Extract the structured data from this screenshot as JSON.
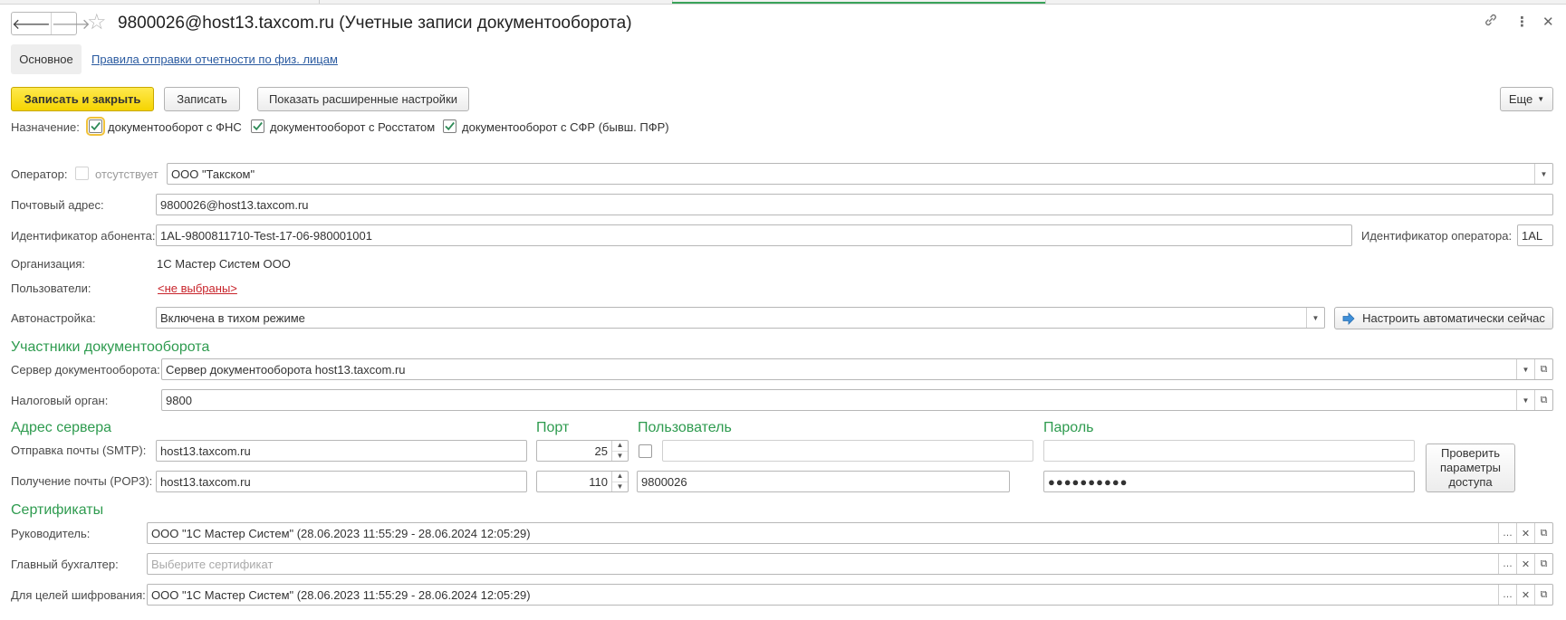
{
  "window": {
    "title": "9800026@host13.taxcom.ru (Учетные записи документооборота)"
  },
  "tabs": {
    "main_label": "Основное",
    "rules_link": "Правила отправки отчетности по физ. лицам"
  },
  "toolbar": {
    "save_close": "Записать и закрыть",
    "save": "Записать",
    "advanced": "Показать расширенные настройки",
    "more": "Еще"
  },
  "purpose": {
    "label": "Назначение:",
    "fns": {
      "label": "документооборот с ФНС",
      "checked": true
    },
    "rosstat": {
      "label": "документооборот с Росстатом",
      "checked": true
    },
    "sfr": {
      "label": "документооборот с СФР (бывш. ПФР)",
      "checked": true
    }
  },
  "operator": {
    "label": "Оператор:",
    "absent_label": "отсутствует",
    "value": "ООО \"Такском\""
  },
  "email": {
    "label": "Почтовый адрес:",
    "value": "9800026@host13.taxcom.ru"
  },
  "subscriber_id": {
    "label": "Идентификатор абонента:",
    "value": "1AL-9800811710-Test-17-06-980001001"
  },
  "operator_id": {
    "label": "Идентификатор оператора:",
    "value": "1AL"
  },
  "organization": {
    "label": "Организация:",
    "value": "1С Мастер Систем ООО"
  },
  "users": {
    "label": "Пользователи:",
    "value": "<не выбраны>"
  },
  "autoconfig": {
    "label": "Автонастройка:",
    "value": "Включена в тихом режиме",
    "button": "Настроить автоматически сейчас"
  },
  "participants": {
    "heading": "Участники документооборота",
    "server_label": "Сервер документооборота:",
    "server_value": "Сервер документооборота host13.taxcom.ru",
    "tax_label": "Налоговый орган:",
    "tax_value": "9800"
  },
  "server": {
    "heading": "Адрес сервера",
    "port_heading": "Порт",
    "user_heading": "Пользователь",
    "password_heading": "Пароль",
    "smtp_label": "Отправка почты (SMTP):",
    "smtp_host": "host13.taxcom.ru",
    "smtp_port": "25",
    "smtp_user": "",
    "smtp_password": "",
    "pop3_label": "Получение почты (POP3):",
    "pop3_host": "host13.taxcom.ru",
    "pop3_port": "110",
    "pop3_user": "9800026",
    "pop3_password": "●●●●●●●●●●",
    "check_button_line1": "Проверить",
    "check_button_line2": "параметры",
    "check_button_line3": "доступа"
  },
  "certificates": {
    "heading": "Сертификаты",
    "head_label": "Руководитель:",
    "head_value": "ООО \"1С Мастер Систем\" (28.06.2023 11:55:29 - 28.06.2024 12:05:29)",
    "accountant_label": "Главный бухгалтер:",
    "accountant_placeholder": "Выберите сертификат",
    "encryption_label": "Для целей шифрования:",
    "encryption_value": "ООО \"1С Мастер Систем\" (28.06.2023 11:55:29 - 28.06.2024 12:05:29)"
  },
  "icons": {
    "back": "arrow-left-icon",
    "forward": "arrow-right-icon",
    "favorite": "star-icon",
    "link": "link-icon",
    "menu": "more-vertical-icon",
    "close": "close-icon",
    "dropdown": "chevron-down-icon",
    "open": "open-window-icon",
    "select": "ellipsis-icon",
    "clear": "clear-icon"
  },
  "colors": {
    "primary_button": "#f5d400",
    "section_heading": "#2e9b4f",
    "link": "#2a5aa0",
    "link_warning": "#c8242b",
    "check": "#2e8b57"
  }
}
